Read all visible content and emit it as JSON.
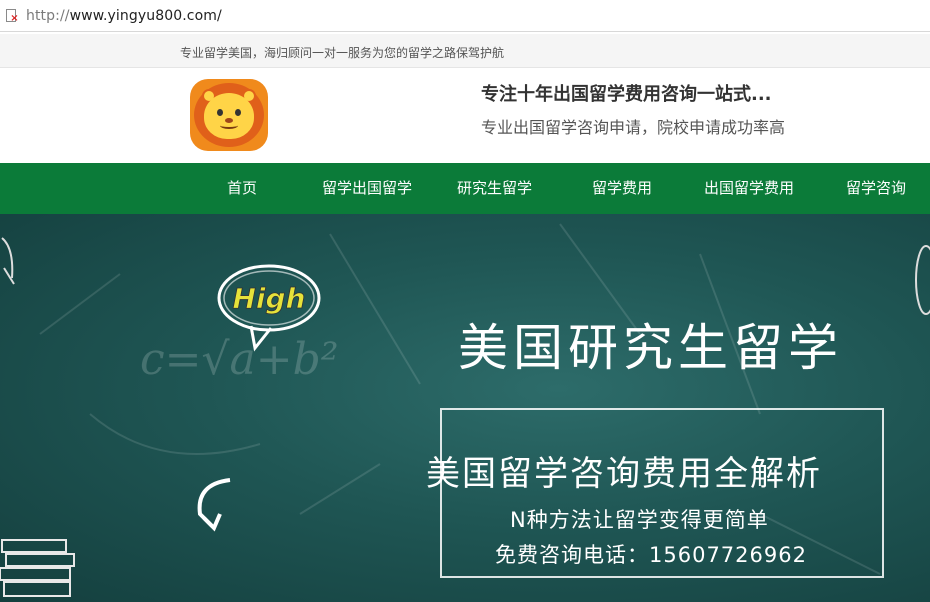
{
  "browser": {
    "url_scheme": "http://",
    "url_rest": "www.yingyu800.com/"
  },
  "top_strip": {
    "slogan": "专业留学美国，海归顾问一对一服务为您的留学之路保驾护航"
  },
  "header": {
    "title": "专注十年出国留学费用咨询一站式...",
    "subtitle": "专业出国留学咨询申请，院校申请成功率高"
  },
  "nav": {
    "items": [
      {
        "label": "首页"
      },
      {
        "label": "留学出国留学"
      },
      {
        "label": "研究生留学"
      },
      {
        "label": "留学费用"
      },
      {
        "label": "出国留学费用"
      },
      {
        "label": "留学咨询"
      }
    ]
  },
  "hero": {
    "title": "美国研究生留学",
    "headline": "美国留学咨询费用全解析",
    "line2": "N种方法让留学变得更简单",
    "phone_line": "免费咨询电话：15607726962",
    "bubble_text": "High",
    "chalk_formula": "c=√a+b²"
  },
  "colors": {
    "nav_bg": "#0b7b39",
    "hero_bg": "#1f5654"
  },
  "icons": [
    "page-error-icon",
    "lion-logo"
  ]
}
